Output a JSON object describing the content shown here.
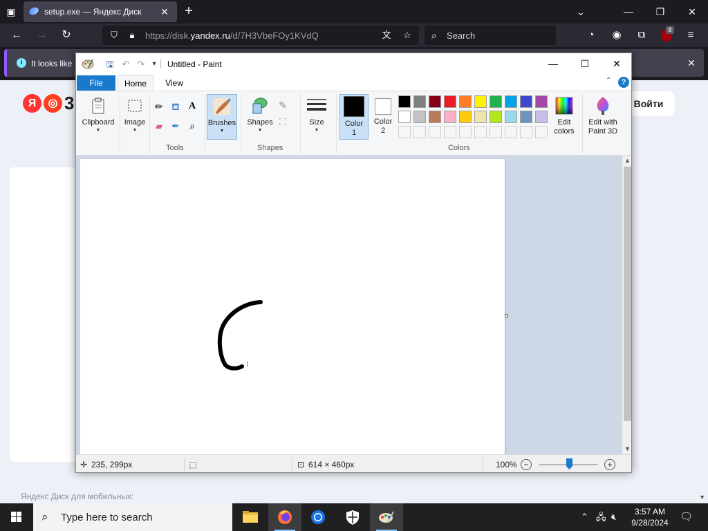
{
  "browser": {
    "tab_title": "setup.exe — Яндекс Диск",
    "url_host": "https://disk.",
    "url_domain": "yandex.ru",
    "url_path": "/d/7H3VbeFOy1KVdQ",
    "search_placeholder": "Search",
    "ublock_count": "8",
    "notification_text": "It looks like"
  },
  "yandex": {
    "logo_letter_1": "Я",
    "logo_letter_3": "3",
    "login_label": "Войти",
    "mobile_text": "Яндекс Диск для мобильных:"
  },
  "paint": {
    "window_title": "Untitled - Paint",
    "tabs": {
      "file": "File",
      "home": "Home",
      "view": "View"
    },
    "groups": {
      "clipboard": "Clipboard",
      "image": "Image",
      "tools": "Tools",
      "brushes": "Brushes",
      "shapes": "Shapes",
      "shapes_group": "Shapes",
      "size": "Size",
      "colors": "Colors"
    },
    "color1_line1": "Color",
    "color1_line2": "1",
    "color2_line1": "Color",
    "color2_line2": "2",
    "edit_colors_line1": "Edit",
    "edit_colors_line2": "colors",
    "paint3d_line1": "Edit with",
    "paint3d_line2": "Paint 3D",
    "palette_row1": [
      "#000000",
      "#7f7f7f",
      "#880015",
      "#ed1c24",
      "#ff7f27",
      "#fff200",
      "#22b14c",
      "#00a2e8",
      "#3f48cc",
      "#a349a4"
    ],
    "palette_row2": [
      "#ffffff",
      "#c3c3c3",
      "#b97a57",
      "#ffaec9",
      "#ffc90e",
      "#efe4b0",
      "#b5e61d",
      "#99d9ea",
      "#7092be",
      "#c8bfe7"
    ],
    "color1_value": "#000000",
    "color2_value": "#ffffff",
    "status": {
      "cursor_pos": "235, 299px",
      "canvas_size": "614 × 460px",
      "zoom": "100%"
    }
  },
  "taskbar": {
    "search_placeholder": "Type here to search",
    "time": "3:57 AM",
    "date": "9/28/2024"
  }
}
